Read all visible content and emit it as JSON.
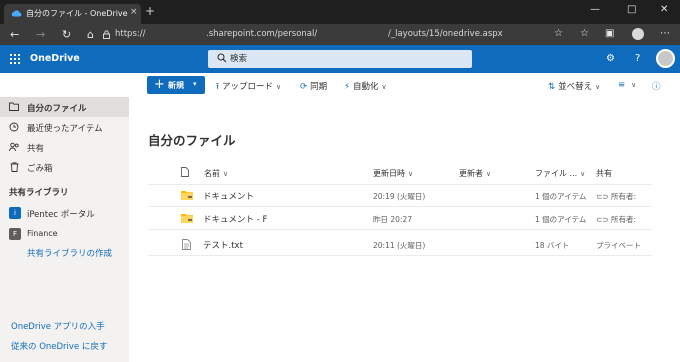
{
  "browser": {
    "tab_title": "自分のファイル - OneDrive",
    "tab_close": "×",
    "new_tab": "+",
    "window_controls": [
      "—",
      "□",
      "✕"
    ],
    "nav": {
      "back": "←",
      "forward": "→",
      "refresh": "↻",
      "home": "⌂"
    },
    "url": {
      "prefix": "https://",
      "host": ".sharepoint.com/personal/",
      "path": "/_layouts/15/onedrive.aspx"
    }
  },
  "app": {
    "name": "OneDrive",
    "search_placeholder": "検索",
    "settings_icon": "⚙",
    "help_icon": "?"
  },
  "commandbar": {
    "new_label": "新規",
    "upload_label": "アップロード",
    "sync_label": "同期",
    "automate_label": "自動化",
    "sort_label": "並べ替え",
    "view_icon": "≡",
    "info_icon": "ⓘ"
  },
  "sidebar": {
    "items": [
      {
        "label": "自分のファイル",
        "icon": "folder-icon"
      },
      {
        "label": "最近使ったアイテム",
        "icon": "clock-icon"
      },
      {
        "label": "共有",
        "icon": "people-icon"
      },
      {
        "label": "ごみ箱",
        "icon": "trash-icon"
      }
    ],
    "libraries_heading": "共有ライブラリ",
    "libraries": [
      {
        "label": "iPentec ポータル",
        "color": "#0f6cbd",
        "letter": "i"
      },
      {
        "label": "Finance",
        "color": "#605e5c",
        "letter": "F"
      }
    ],
    "create_library": "共有ライブラリの作成",
    "get_app": "OneDrive アプリの入手",
    "back_to_classic": "従来の OneDrive に戻す"
  },
  "main": {
    "title": "自分のファイル",
    "columns": {
      "name": "名前",
      "modified": "更新日時",
      "modified_by": "更新者",
      "size": "ファイル ...",
      "sharing": "共有"
    },
    "rows": [
      {
        "name": "ドキュメント",
        "type": "folder",
        "modified": "20:19 (火曜日)",
        "size": "1 個のアイテム",
        "sharing": "所有者:"
      },
      {
        "name": "ドキュメント - F",
        "type": "folder",
        "modified": "昨日 20:27",
        "size": "1 個のアイテム",
        "sharing": "所有者:"
      },
      {
        "name": "テスト.txt",
        "type": "file",
        "modified": "20:11 (火曜日)",
        "size": "18 バイト",
        "sharing": "プライベート"
      }
    ]
  },
  "colors": {
    "brand": "#0f6cbd",
    "nav_bg": "#f3f2f1",
    "folder": "#ffb900"
  }
}
